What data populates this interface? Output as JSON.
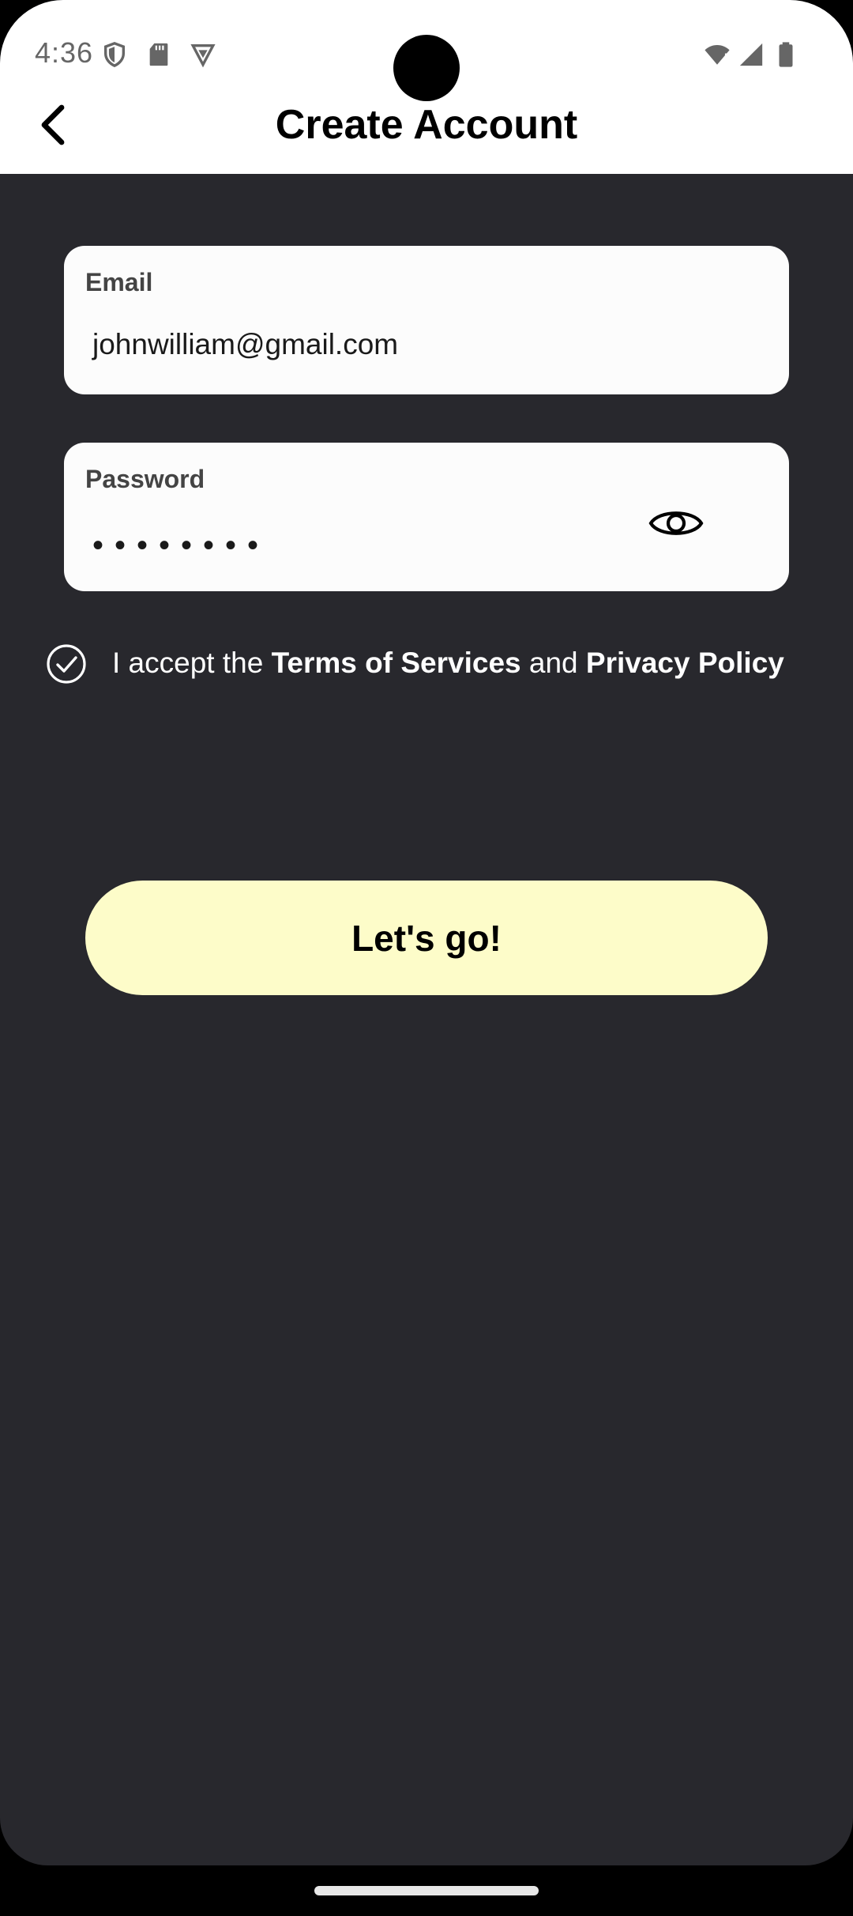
{
  "status_bar": {
    "time": "4:36",
    "left_icons": [
      "shield-icon",
      "sd-card-icon",
      "vpn-icon"
    ],
    "right_icons": [
      "wifi-alert-icon",
      "signal-icon",
      "battery-icon"
    ]
  },
  "header": {
    "back_icon": "chevron-left-icon",
    "title": "Create Account"
  },
  "form": {
    "email": {
      "label": "Email",
      "value": "johnwilliam@gmail.com"
    },
    "password": {
      "label": "Password",
      "masked_value": "••••••••",
      "toggle_icon": "eye-icon"
    },
    "terms": {
      "checked": true,
      "prefix": "I accept the ",
      "terms_link": "Terms of Services",
      "middle": " and ",
      "privacy_link": "Privacy Policy"
    },
    "submit_label": "Let's go!"
  },
  "colors": {
    "background": "#28282d",
    "header": "#ffffff",
    "field": "#fcfcfc",
    "cta": "#fdfcc9"
  }
}
